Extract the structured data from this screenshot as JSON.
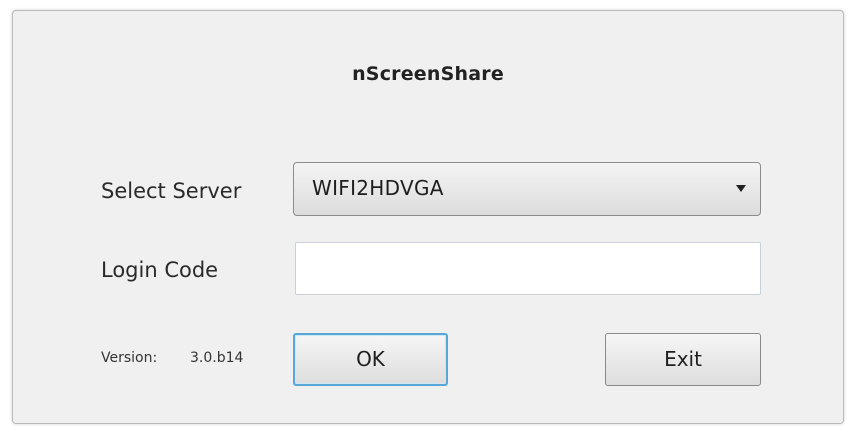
{
  "dialog": {
    "title": "nScreenShare",
    "server": {
      "label": "Select Server",
      "selected": "WIFI2HDVGA"
    },
    "login": {
      "label": "Login Code",
      "value": ""
    },
    "version": {
      "label": "Version:",
      "value": "3.0.b14"
    },
    "buttons": {
      "ok": "OK",
      "exit": "Exit"
    }
  },
  "colors": {
    "dialog_background": "#f0f0f0",
    "ok_focus_border": "#58a7d6"
  },
  "icons": {
    "dropdown": "chevron-down-icon"
  }
}
